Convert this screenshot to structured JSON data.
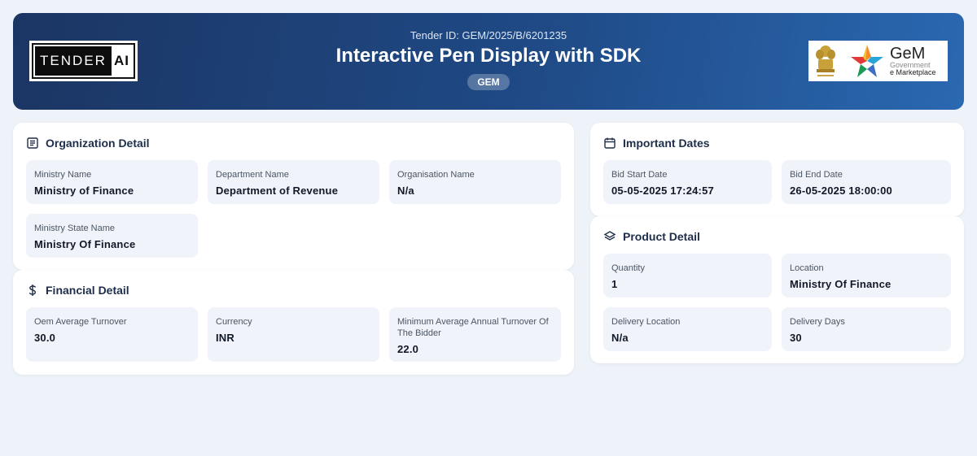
{
  "header": {
    "tender_id": "Tender ID: GEM/2025/B/6201235",
    "title": "Interactive Pen Display with SDK",
    "source_badge": "GEM",
    "logo_left": {
      "word1": "TENDER",
      "word2": "AI"
    },
    "logo_right": {
      "brand": "GeM",
      "line1": "Government",
      "line2": "e Marketplace"
    }
  },
  "organization": {
    "title": "Organization Detail",
    "icon": "document-icon",
    "fields": [
      {
        "label": "Ministry Name",
        "value": "Ministry of Finance"
      },
      {
        "label": "Department Name",
        "value": "Department of Revenue"
      },
      {
        "label": "Organisation Name",
        "value": "N/a"
      },
      {
        "label": "Ministry State Name",
        "value": "Ministry Of Finance"
      }
    ]
  },
  "financial": {
    "title": "Financial Detail",
    "icon": "dollar-icon",
    "fields": [
      {
        "label": "Oem Average Turnover",
        "value": "30.0"
      },
      {
        "label": "Currency",
        "value": "INR"
      },
      {
        "label": "Minimum Average Annual Turnover Of The Bidder",
        "value": "22.0"
      }
    ]
  },
  "dates": {
    "title": "Important Dates",
    "icon": "calendar-icon",
    "fields": [
      {
        "label": "Bid Start Date",
        "value": "05-05-2025 17:24:57"
      },
      {
        "label": "Bid End Date",
        "value": "26-05-2025 18:00:00"
      }
    ]
  },
  "product": {
    "title": "Product Detail",
    "icon": "layers-icon",
    "fields": [
      {
        "label": "Quantity",
        "value": "1"
      },
      {
        "label": "Location",
        "value": "Ministry Of Finance"
      },
      {
        "label": "Delivery Location",
        "value": "N/a"
      },
      {
        "label": "Delivery Days",
        "value": "30"
      }
    ]
  }
}
